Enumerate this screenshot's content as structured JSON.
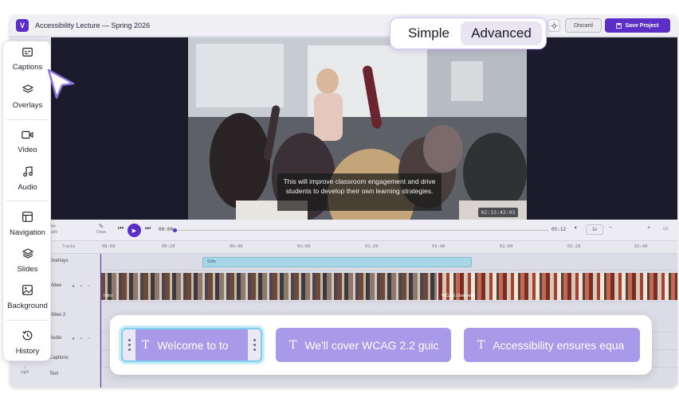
{
  "app": {
    "logo_letter": "V",
    "project_title": "Accessibility Lecture — Spring 2026",
    "discard_label": "Discard",
    "save_label": "Save Project",
    "accent_color": "#5b2fc7"
  },
  "mode_toggle": {
    "simple_label": "Simple",
    "advanced_label": "Advanced",
    "selected": "Advanced"
  },
  "sidebar": {
    "items": [
      {
        "label": "Captions",
        "icon": "captions-icon"
      },
      {
        "label": "Overlays",
        "icon": "layers-icon"
      },
      {
        "label": "Video",
        "icon": "video-camera-icon"
      },
      {
        "label": "Audio",
        "icon": "music-note-icon"
      },
      {
        "label": "Navigation",
        "icon": "navigation-layout-icon"
      },
      {
        "label": "Slides",
        "icon": "slides-stack-icon"
      },
      {
        "label": "Background",
        "icon": "image-icon"
      },
      {
        "label": "History",
        "icon": "history-icon"
      }
    ]
  },
  "preview": {
    "caption_text": "This will improve classroom engagement and drive students to develop their own learning strategies.",
    "timecode": "02:13:42:03"
  },
  "timeline": {
    "tools": [
      "Split",
      "Draw"
    ],
    "current_time": "00:00",
    "total_time": "05:12",
    "speed": "1x",
    "ruler_marks": [
      "00:00",
      "00:20",
      "00:40",
      "01:00",
      "01:20",
      "01:40",
      "02:00",
      "02:20",
      "02:40"
    ],
    "tracks_header": "Tracks",
    "tracks": [
      "Overlays",
      "Video",
      "Video 2",
      "Audio",
      "Captions",
      "Text"
    ],
    "slide_clip_label": "Slide",
    "video_clip_labels": [
      "Intro",
      "WCAG Overview"
    ],
    "light_label": "Light"
  },
  "caption_clips": [
    {
      "text": "Welcome to to",
      "selected": true
    },
    {
      "text": "We'll cover WCAG 2.2 guic",
      "selected": false
    },
    {
      "text": "Accessibility ensures equa",
      "selected": false
    }
  ]
}
